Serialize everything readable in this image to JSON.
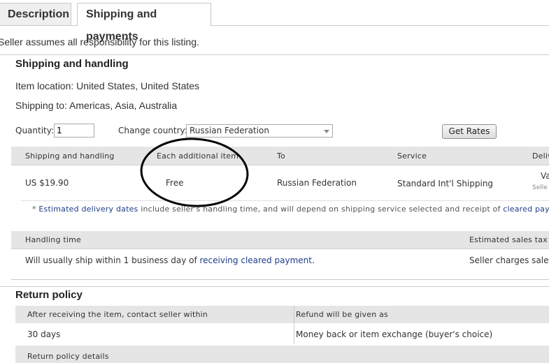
{
  "tabs": [
    {
      "label": "Description"
    },
    {
      "label": "Shipping and payments"
    }
  ],
  "responsibility_text": "Seller assumes all responsibility for this listing.",
  "shipping": {
    "title": "Shipping and handling",
    "item_location": "Item location: United States, United States",
    "shipping_to": "Shipping to: Americas, Asia, Australia",
    "quantity_label": "Quantity:",
    "quantity_value": "1",
    "change_country_label": "Change country:",
    "country_selected": "Russian Federation",
    "get_rates_label": "Get Rates",
    "table": {
      "headers": [
        "Shipping and handling",
        "Each additional item",
        "To",
        "Service",
        "Deliv"
      ],
      "row": [
        "US $19.90",
        "Free",
        "Russian Federation",
        "Standard Int'l Shipping",
        "Va",
        "Selle"
      ]
    },
    "footnote": {
      "star": "*",
      "link1": "Estimated delivery dates",
      "middle": "include seller's handling time, and will depend on shipping service selected and receipt of",
      "link2": "cleared paymen"
    }
  },
  "handling": {
    "header_left": "Handling time",
    "header_right": "Estimated sales tax",
    "text_before": "Will usually ship within 1 business day of",
    "link": "receiving cleared payment",
    "text_after": ".",
    "right_text": "Seller charges sales"
  },
  "returns": {
    "title": "Return policy",
    "header_left": "After receiving the item, contact seller within",
    "header_right": "Refund will be given as",
    "value_left": "30 days",
    "value_right": "Money back or item exchange (buyer's choice)",
    "details_label": "Return policy details"
  },
  "colors": {
    "link": "#1f3d8a",
    "header_bar": "#e5e5e5",
    "annotation": "#000000"
  }
}
